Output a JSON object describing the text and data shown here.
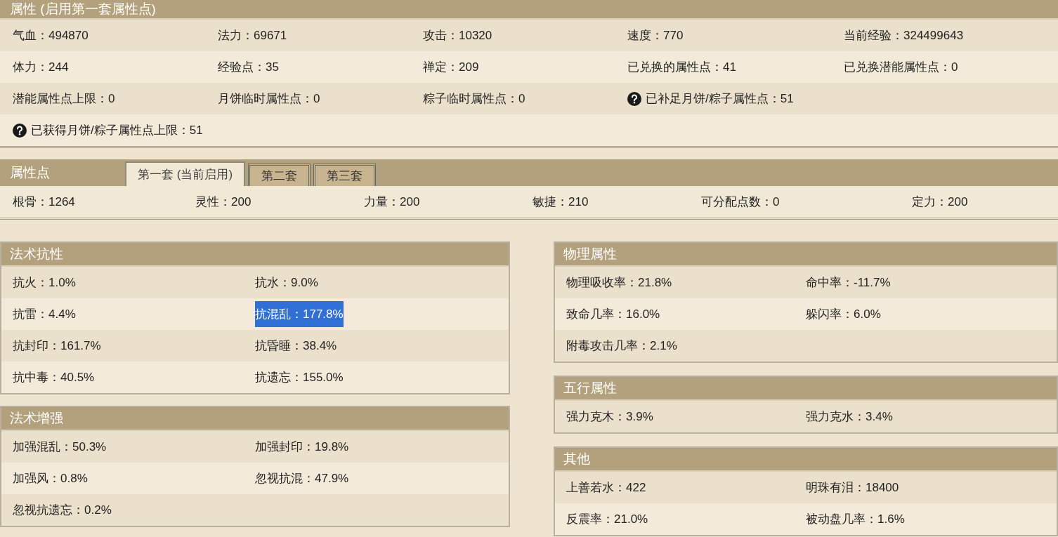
{
  "attributes": {
    "title": "属性 (启用第一套属性点)",
    "rows": [
      [
        {
          "text": "气血：494870",
          "help": false
        },
        {
          "text": "法力：69671",
          "help": false
        },
        {
          "text": "攻击：10320",
          "help": false
        },
        {
          "text": "速度：770",
          "help": false
        },
        {
          "text": "当前经验：324499643",
          "help": false
        }
      ],
      [
        {
          "text": "体力：244",
          "help": false
        },
        {
          "text": "经验点：35",
          "help": false
        },
        {
          "text": "禅定：209",
          "help": false
        },
        {
          "text": "已兑换的属性点：41",
          "help": false
        },
        {
          "text": "已兑换潜能属性点：0",
          "help": false
        }
      ],
      [
        {
          "text": "潜能属性点上限：0",
          "help": false
        },
        {
          "text": "月饼临时属性点：0",
          "help": false
        },
        {
          "text": "粽子临时属性点：0",
          "help": false
        },
        {
          "text": "已补足月饼/粽子属性点：51",
          "help": true
        }
      ],
      [
        {
          "text": "已获得月饼/粽子属性点上限：51",
          "help": true
        }
      ]
    ]
  },
  "attribute_points": {
    "title": "属性点",
    "tabs": [
      {
        "label": "第一套 (当前启用)",
        "selected": true
      },
      {
        "label": "第二套",
        "selected": false
      },
      {
        "label": "第三套",
        "selected": false
      }
    ],
    "values": [
      "根骨：1264",
      "灵性：200",
      "力量：200",
      "敏捷：210",
      "可分配点数：0",
      "定力：200"
    ]
  },
  "left_sections": [
    {
      "title": "法术抗性",
      "items": [
        {
          "text": "抗火：1.0%",
          "highlighted": false
        },
        {
          "text": "抗水：9.0%",
          "highlighted": false
        },
        {
          "text": "抗雷：4.4%",
          "highlighted": false
        },
        {
          "text": "抗混乱：177.8%",
          "highlighted": true
        },
        {
          "text": "抗封印：161.7%",
          "highlighted": false
        },
        {
          "text": "抗昏睡：38.4%",
          "highlighted": false
        },
        {
          "text": "抗中毒：40.5%",
          "highlighted": false
        },
        {
          "text": "抗遗忘：155.0%",
          "highlighted": false
        }
      ]
    },
    {
      "title": "法术增强",
      "items": [
        {
          "text": "加强混乱：50.3%"
        },
        {
          "text": "加强封印：19.8%"
        },
        {
          "text": "加强风：0.8%"
        },
        {
          "text": "忽视抗混：47.9%"
        },
        {
          "text": "忽视抗遗忘：0.2%"
        }
      ]
    }
  ],
  "right_sections": [
    {
      "title": "物理属性",
      "items": [
        {
          "text": "物理吸收率：21.8%"
        },
        {
          "text": "命中率：-11.7%"
        },
        {
          "text": "致命几率：16.0%"
        },
        {
          "text": "躲闪率：6.0%"
        },
        {
          "text": "附毒攻击几率：2.1%"
        }
      ]
    },
    {
      "title": "五行属性",
      "items": [
        {
          "text": "强力克木：3.9%"
        },
        {
          "text": "强力克水：3.4%"
        }
      ]
    },
    {
      "title": "其他",
      "items": [
        {
          "text": "上善若水：422"
        },
        {
          "text": "明珠有泪：18400"
        },
        {
          "text": "反震率：21.0%"
        },
        {
          "text": "被动盘几率：1.6%"
        }
      ]
    }
  ]
}
